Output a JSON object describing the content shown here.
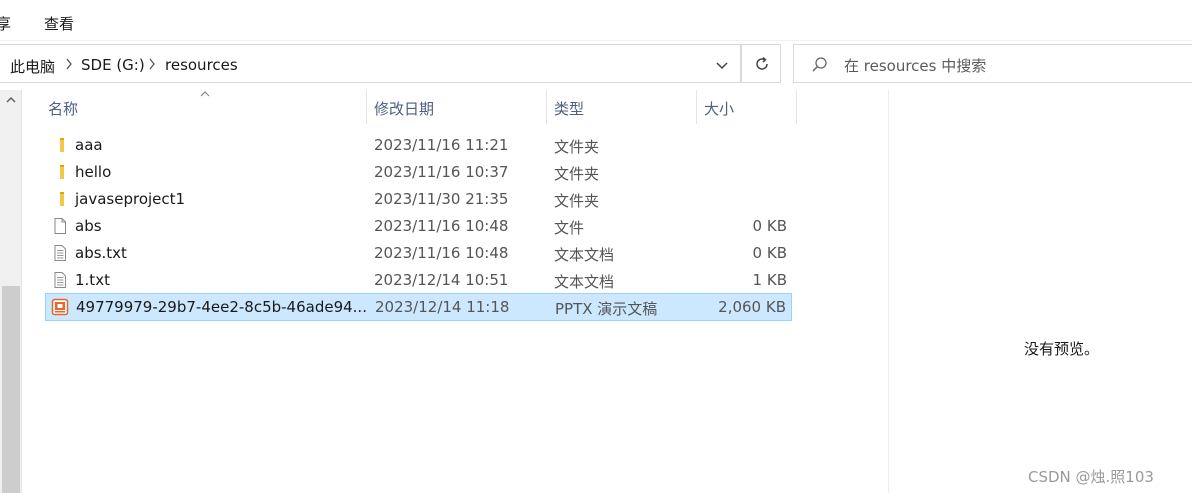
{
  "ribbon": {
    "tabs": [
      "享",
      "查看"
    ]
  },
  "address": {
    "crumbs": [
      "此电脑",
      "SDE (G:)",
      "resources"
    ]
  },
  "search": {
    "placeholder": "在 resources 中搜索"
  },
  "columns": {
    "name": "名称",
    "date": "修改日期",
    "type": "类型",
    "size": "大小"
  },
  "files": [
    {
      "name": "aaa",
      "date": "2023/11/16 11:21",
      "type": "文件夹",
      "size": "",
      "icon": "folder-icon"
    },
    {
      "name": "hello",
      "date": "2023/11/16 10:37",
      "type": "文件夹",
      "size": "",
      "icon": "folder-icon"
    },
    {
      "name": "javaseproject1",
      "date": "2023/11/30 21:35",
      "type": "文件夹",
      "size": "",
      "icon": "folder-icon"
    },
    {
      "name": "abs",
      "date": "2023/11/16 10:48",
      "type": "文件",
      "size": "0 KB",
      "icon": "file-icon"
    },
    {
      "name": "abs.txt",
      "date": "2023/11/16 10:48",
      "type": "文本文档",
      "size": "0 KB",
      "icon": "text-file-icon"
    },
    {
      "name": "1.txt",
      "date": "2023/12/14 10:51",
      "type": "文本文档",
      "size": "1 KB",
      "icon": "text-file-icon"
    },
    {
      "name": "49779979-29b7-4ee2-8c5b-46ade94...",
      "date": "2023/12/14 11:18",
      "type": "PPTX 演示文稿",
      "size": "2,060 KB",
      "icon": "pptx-file-icon",
      "selected": true
    }
  ],
  "preview": {
    "empty_text": "没有预览。"
  },
  "watermark": "CSDN @烛.照103",
  "colors": {
    "selection_bg": "#cce8ff",
    "selection_border": "#99d1ff",
    "header_text": "#4d6082",
    "folder": "#f2c94c",
    "pptx": "#e8652b"
  }
}
